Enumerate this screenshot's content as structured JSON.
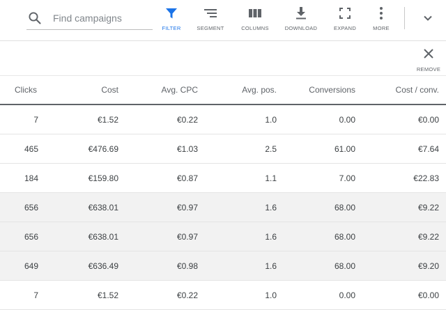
{
  "toolbar": {
    "search": {
      "placeholder": "Find campaigns",
      "value": ""
    },
    "tools": [
      {
        "label": "FILTER",
        "icon": "filter-icon",
        "active": true
      },
      {
        "label": "SEGMENT",
        "icon": "segment-icon",
        "active": false
      },
      {
        "label": "COLUMNS",
        "icon": "columns-icon",
        "active": false
      },
      {
        "label": "DOWNLOAD",
        "icon": "download-icon",
        "active": false
      },
      {
        "label": "EXPAND",
        "icon": "expand-icon",
        "active": false
      },
      {
        "label": "MORE",
        "icon": "more-vert-icon",
        "active": false
      }
    ],
    "accent_color": "#1a73e8",
    "expand_menu_icon": "chevron-down-icon"
  },
  "remove": {
    "label": "REMOVE",
    "icon": "close-icon"
  },
  "table": {
    "headers": [
      "Clicks",
      "Cost",
      "Avg. CPC",
      "Avg. pos.",
      "Conversions",
      "Cost / conv."
    ],
    "rows": [
      [
        "7",
        "€1.52",
        "€0.22",
        "1.0",
        "0.00",
        "€0.00"
      ],
      [
        "465",
        "€476.69",
        "€1.03",
        "2.5",
        "61.00",
        "€7.64"
      ],
      [
        "184",
        "€159.80",
        "€0.87",
        "1.1",
        "7.00",
        "€22.83"
      ],
      [
        "656",
        "€638.01",
        "€0.97",
        "1.6",
        "68.00",
        "€9.22"
      ],
      [
        "656",
        "€638.01",
        "€0.97",
        "1.6",
        "68.00",
        "€9.22"
      ],
      [
        "649",
        "€636.49",
        "€0.98",
        "1.6",
        "68.00",
        "€9.20"
      ],
      [
        "7",
        "€1.52",
        "€0.22",
        "1.0",
        "0.00",
        "€0.00"
      ]
    ],
    "shaded_rows": [
      3,
      4,
      5
    ],
    "shaded_color": "#f2f2f2"
  }
}
